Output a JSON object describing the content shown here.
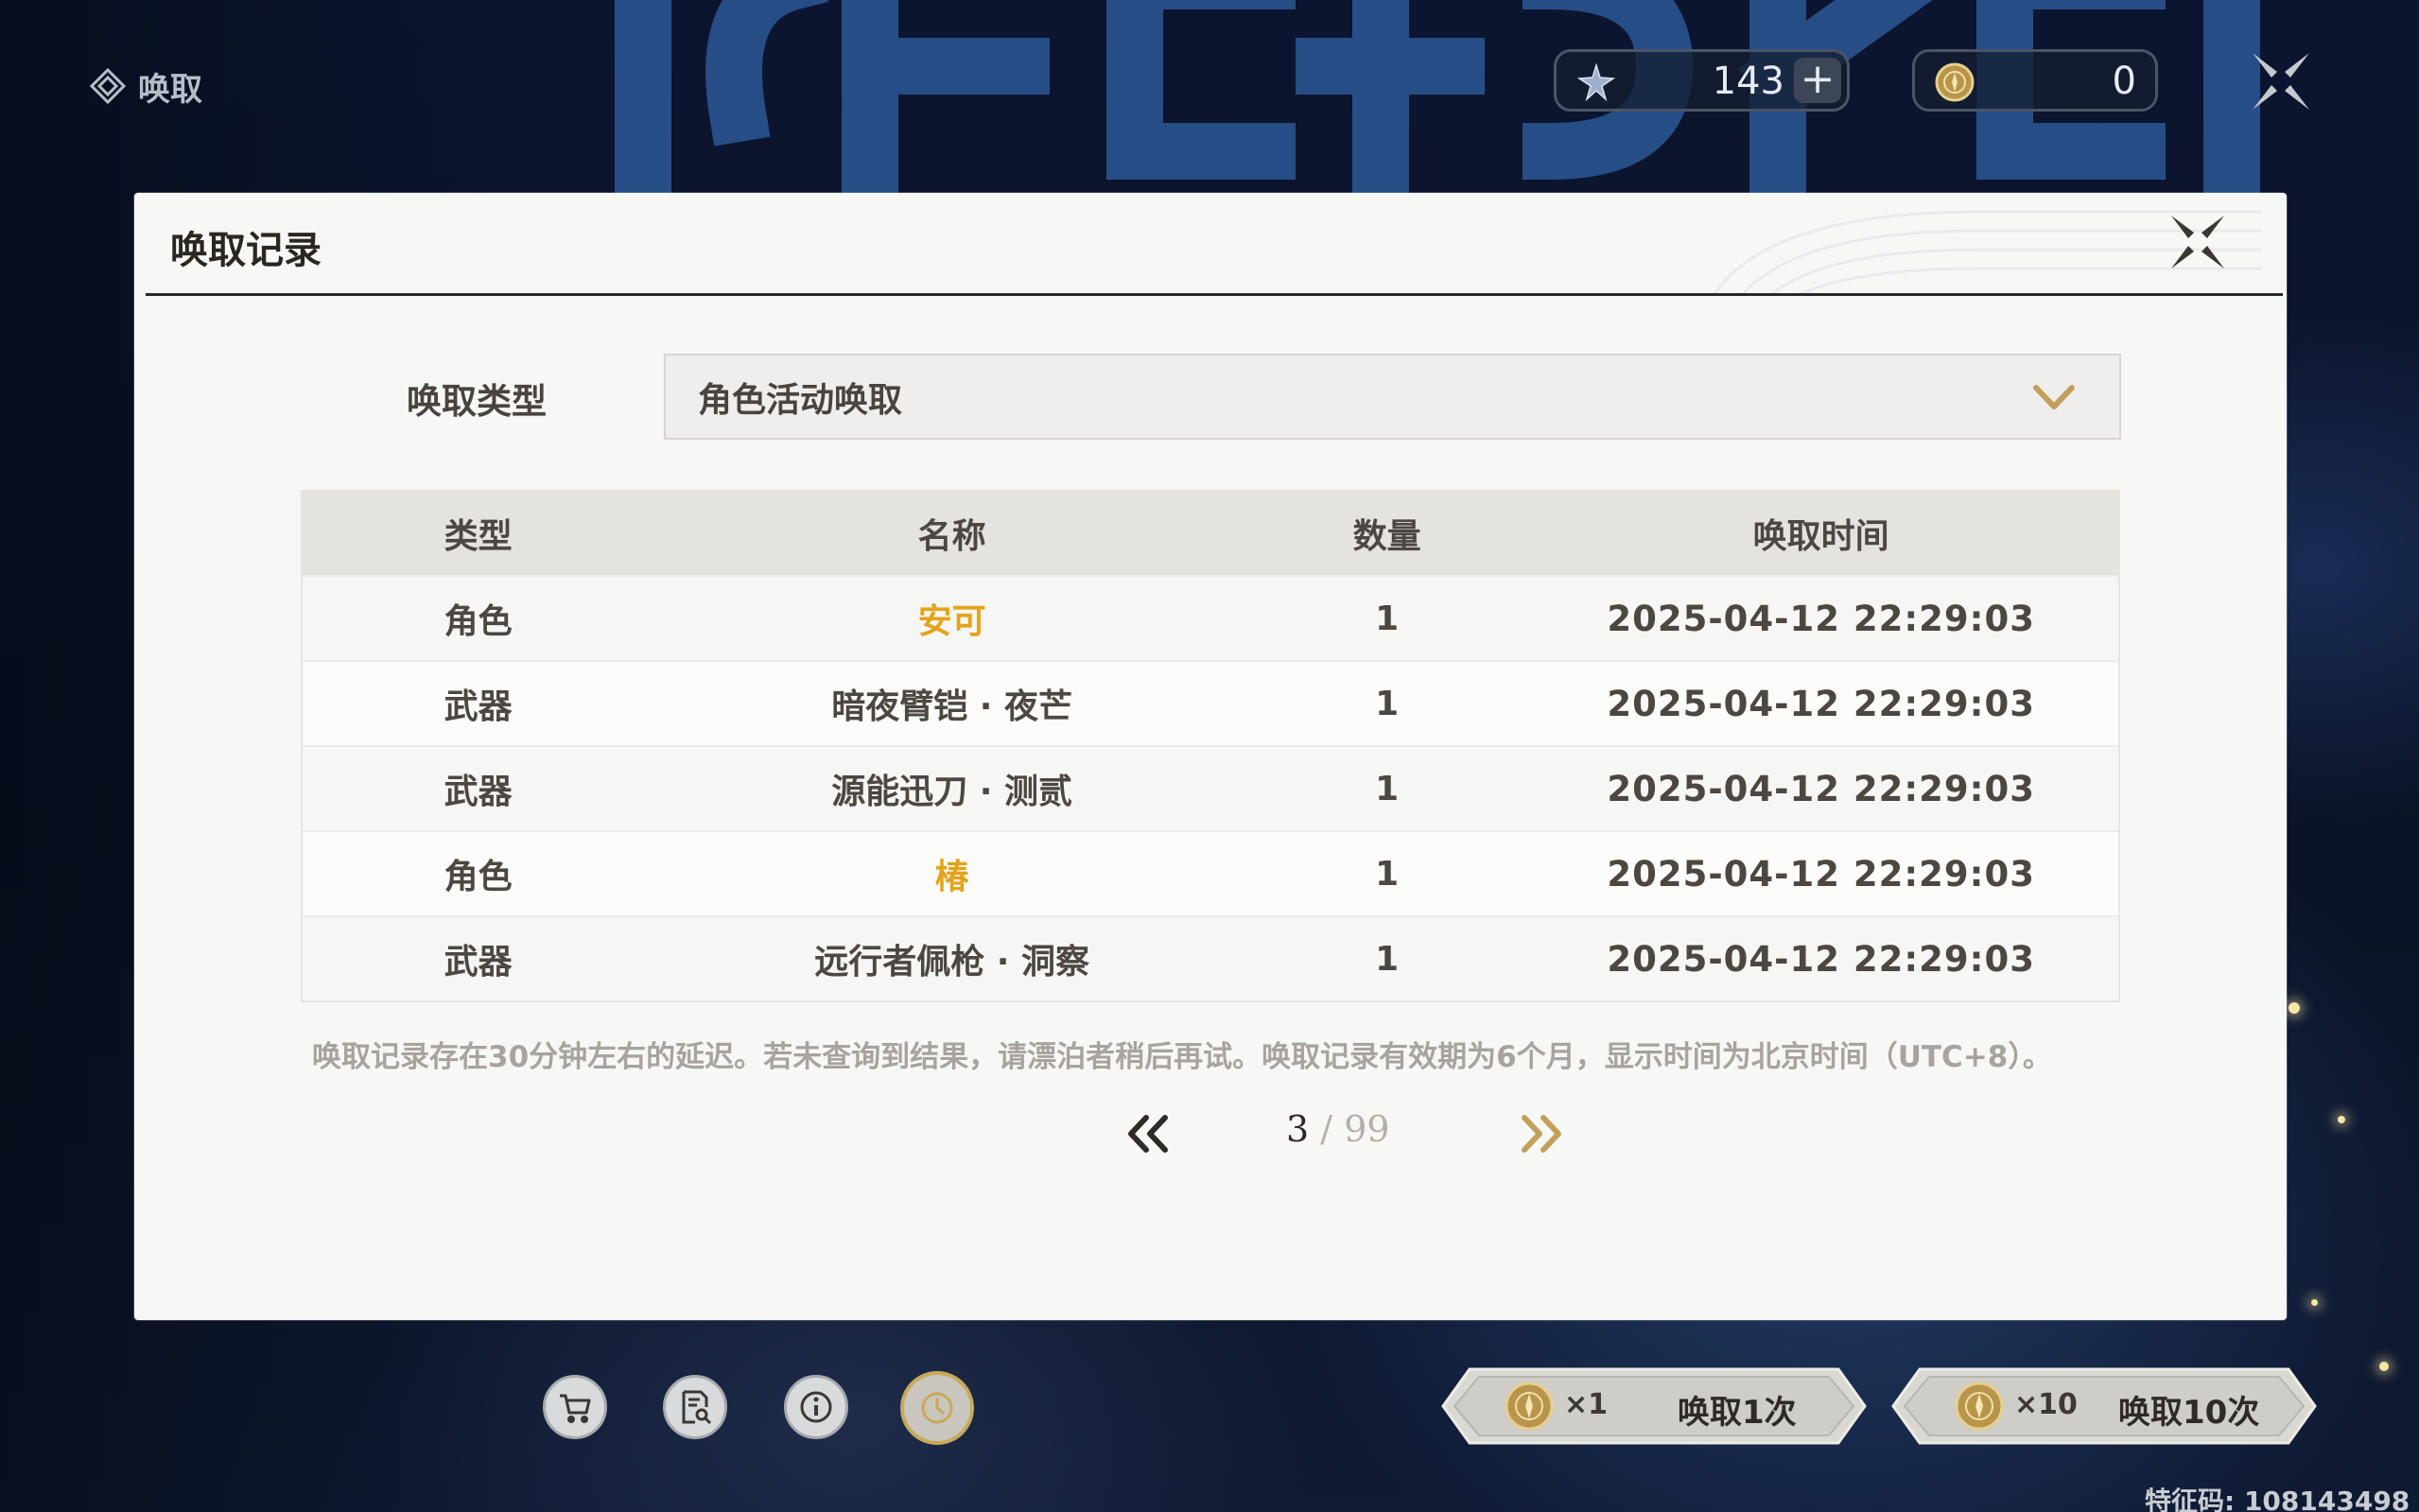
{
  "topbar": {
    "title": "唤取",
    "title_icon": "summon-compass-icon",
    "star_currency": {
      "icon": "star-icon",
      "value": "143",
      "plus_icon": "plus-icon"
    },
    "coin_currency": {
      "icon": "coin-icon",
      "value": "0"
    },
    "close_icon": "close-icon"
  },
  "dialog": {
    "title": "唤取记录",
    "close_icon": "close-icon",
    "type_label": "唤取类型",
    "type_select": {
      "value": "角色活动唤取",
      "icon": "chevron-down-icon"
    },
    "table": {
      "headers": [
        "类型",
        "名称",
        "数量",
        "唤取时间"
      ],
      "rows": [
        {
          "type": "角色",
          "name": "安可",
          "qty": "1",
          "time": "2025-04-12 22:29:03",
          "highlight": true
        },
        {
          "type": "武器",
          "name": "暗夜臂铠 · 夜芒",
          "qty": "1",
          "time": "2025-04-12 22:29:03",
          "highlight": false
        },
        {
          "type": "武器",
          "name": "源能迅刀 · 测贰",
          "qty": "1",
          "time": "2025-04-12 22:29:03",
          "highlight": false
        },
        {
          "type": "角色",
          "name": "椿",
          "qty": "1",
          "time": "2025-04-12 22:29:03",
          "highlight": true
        },
        {
          "type": "武器",
          "name": "远行者佩枪 · 洞察",
          "qty": "1",
          "time": "2025-04-12 22:29:03",
          "highlight": false
        }
      ]
    },
    "notice": "唤取记录存在30分钟左右的延迟。若未查询到结果，请漂泊者稍后再试。唤取记录有效期为6个月，显示时间为北京时间（UTC+8）。",
    "pagination": {
      "current": "3",
      "separator": "/",
      "total": "99",
      "prev_icon": "double-chevron-left-icon",
      "next_icon": "double-chevron-right-icon"
    }
  },
  "toolbar": {
    "buttons": [
      {
        "name": "shop-button",
        "icon": "cart-icon"
      },
      {
        "name": "details-button",
        "icon": "document-search-icon"
      },
      {
        "name": "info-button",
        "icon": "info-icon"
      },
      {
        "name": "history-button",
        "icon": "clock-icon",
        "active": true
      }
    ]
  },
  "summon": {
    "single": {
      "cost_icon": "coin-icon",
      "cost": "×1",
      "label": "唤取1次"
    },
    "multi": {
      "cost_icon": "coin-icon",
      "cost": "×10",
      "label": "唤取10次"
    }
  },
  "footer": {
    "feature_code": "特征码: 108143498"
  },
  "colors": {
    "highlight": "#e3a41a",
    "accent_gold": "#c8a95a",
    "dialog_bg": "#f7f8f6"
  }
}
